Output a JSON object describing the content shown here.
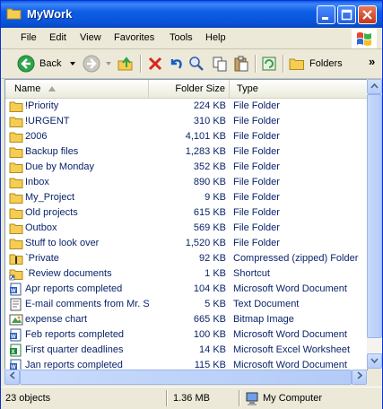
{
  "window": {
    "title": "MyWork"
  },
  "menu": [
    "File",
    "Edit",
    "View",
    "Favorites",
    "Tools",
    "Help"
  ],
  "toolbar": {
    "back_label": "Back",
    "folders_label": "Folders",
    "more_label": "»"
  },
  "columns": {
    "name": "Name",
    "size": "Folder Size",
    "type": "Type"
  },
  "files": [
    {
      "name": "!Priority",
      "size": "224 KB",
      "type": "File Folder",
      "icon": "folder-icon"
    },
    {
      "name": "!URGENT",
      "size": "310 KB",
      "type": "File Folder",
      "icon": "folder-icon"
    },
    {
      "name": "2006",
      "size": "4,101 KB",
      "type": "File Folder",
      "icon": "folder-icon"
    },
    {
      "name": "Backup files",
      "size": "1,283 KB",
      "type": "File Folder",
      "icon": "folder-icon"
    },
    {
      "name": "Due by Monday",
      "size": "352 KB",
      "type": "File Folder",
      "icon": "folder-icon"
    },
    {
      "name": "Inbox",
      "size": "890 KB",
      "type": "File Folder",
      "icon": "folder-icon"
    },
    {
      "name": "My_Project",
      "size": "9 KB",
      "type": "File Folder",
      "icon": "folder-icon"
    },
    {
      "name": "Old projects",
      "size": "615 KB",
      "type": "File Folder",
      "icon": "folder-icon"
    },
    {
      "name": "Outbox",
      "size": "569 KB",
      "type": "File Folder",
      "icon": "folder-icon"
    },
    {
      "name": "Stuff to look over",
      "size": "1,520 KB",
      "type": "File Folder",
      "icon": "folder-icon"
    },
    {
      "name": "`Private",
      "size": "92 KB",
      "type": "Compressed (zipped) Folder",
      "icon": "zip-folder-icon"
    },
    {
      "name": "`Review documents",
      "size": "1 KB",
      "type": "Shortcut",
      "icon": "shortcut-folder-icon"
    },
    {
      "name": "Apr reports completed",
      "size": "104 KB",
      "type": "Microsoft Word Document",
      "icon": "word-document-icon"
    },
    {
      "name": "E-mail comments from Mr. S.",
      "size": "5 KB",
      "type": "Text Document",
      "icon": "text-document-icon"
    },
    {
      "name": "expense chart",
      "size": "665 KB",
      "type": "Bitmap Image",
      "icon": "bitmap-image-icon"
    },
    {
      "name": "Feb reports completed",
      "size": "100 KB",
      "type": "Microsoft Word Document",
      "icon": "word-document-icon"
    },
    {
      "name": "First quarter deadlines",
      "size": "14 KB",
      "type": "Microsoft Excel Worksheet",
      "icon": "excel-worksheet-icon"
    },
    {
      "name": "Jan reports completed",
      "size": "115 KB",
      "type": "Microsoft Word Document",
      "icon": "word-document-icon"
    }
  ],
  "status": {
    "objects": "23 objects",
    "size": "1.36 MB",
    "location": "My Computer"
  },
  "colors": {
    "title_bar": "#0a5ae8",
    "link_text": "#0a246a",
    "folder": "#f5cd52",
    "list_border": "#7f9db9"
  }
}
